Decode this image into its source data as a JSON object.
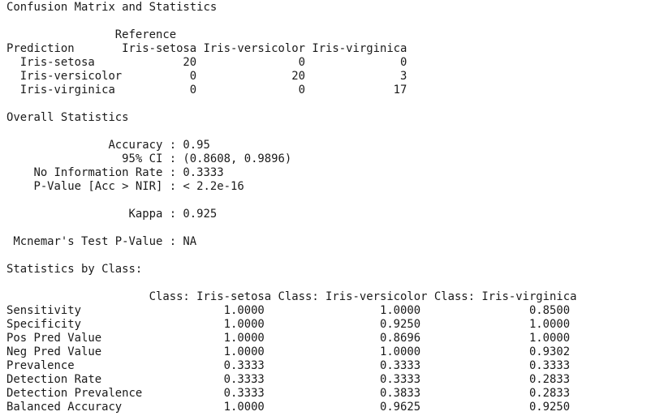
{
  "console": {
    "lines": [
      "Confusion Matrix and Statistics",
      "",
      "                Reference",
      "Prediction       Iris-setosa Iris-versicolor Iris-virginica",
      "  Iris-setosa             20               0              0",
      "  Iris-versicolor          0              20              3",
      "  Iris-virginica           0               0             17",
      "",
      "Overall Statistics",
      "",
      "               Accuracy : 0.95",
      "                 95% CI : (0.8608, 0.9896)",
      "    No Information Rate : 0.3333",
      "    P-Value [Acc > NIR] : < 2.2e-16",
      "",
      "                  Kappa : 0.925",
      "",
      " Mcnemar's Test P-Value : NA",
      "",
      "Statistics by Class:",
      "",
      "                     Class: Iris-setosa Class: Iris-versicolor Class: Iris-virginica",
      "Sensitivity                     1.0000                 1.0000                0.8500",
      "Specificity                     1.0000                 0.9250                1.0000",
      "Pos Pred Value                  1.0000                 0.8696                1.0000",
      "Neg Pred Value                  1.0000                 1.0000                0.9302",
      "Prevalence                      0.3333                 0.3333                0.3333",
      "Detection Rate                  0.3333                 0.3333                0.2833",
      "Detection Prevalence            0.3333                 0.3833                0.2833",
      "Balanced Accuracy               1.0000                 0.9625                0.9250"
    ]
  }
}
